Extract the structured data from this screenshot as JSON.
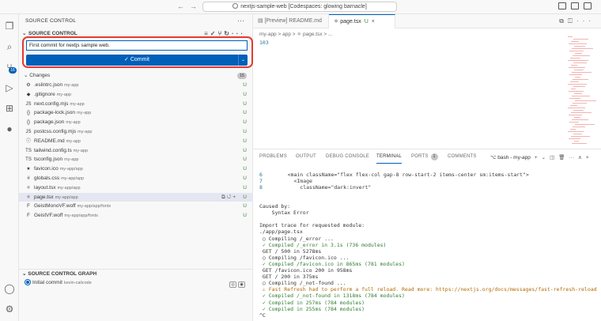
{
  "titlebar": {
    "back": "←",
    "forward": "→",
    "command_center": "nextjs-sample-web [Codespaces: glowing barnacle]"
  },
  "activity_bar": {
    "source_control_badge": "16",
    "icons": [
      "files-icon",
      "search-icon",
      "source-control-icon",
      "run-debug-icon",
      "extensions-icon",
      "github-icon",
      "account-icon",
      "settings-icon"
    ]
  },
  "sidebar": {
    "title": "SOURCE CONTROL",
    "more": "···",
    "section_title": "SOURCE CONTROL",
    "commit_message": "First commit for nextjs sample web.",
    "commit_button": "✓ Commit",
    "changes_label": "Changes",
    "changes_count": "15",
    "files": [
      {
        "name": ".eslintrc.json",
        "path": "my-app",
        "status": "U",
        "icon": "⚙"
      },
      {
        "name": ".gitignore",
        "path": "my-app",
        "status": "U",
        "icon": "◆"
      },
      {
        "name": "next.config.mjs",
        "path": "my-app",
        "status": "U",
        "icon": "JS"
      },
      {
        "name": "package-lock.json",
        "path": "my-app",
        "status": "U",
        "icon": "{}"
      },
      {
        "name": "package.json",
        "path": "my-app",
        "status": "U",
        "icon": "{}"
      },
      {
        "name": "postcss.config.mjs",
        "path": "my-app",
        "status": "U",
        "icon": "JS"
      },
      {
        "name": "README.md",
        "path": "my-app",
        "status": "U",
        "icon": "ⓘ"
      },
      {
        "name": "tailwind.config.ts",
        "path": "my-app",
        "status": "U",
        "icon": "TS"
      },
      {
        "name": "tsconfig.json",
        "path": "my-app",
        "status": "U",
        "icon": "TS"
      },
      {
        "name": "favicon.ico",
        "path": "my-app/app",
        "status": "U",
        "icon": "★"
      },
      {
        "name": "globals.css",
        "path": "my-app/app",
        "status": "U",
        "icon": "#"
      },
      {
        "name": "layout.tsx",
        "path": "my-app/app",
        "status": "U",
        "icon": "⚛"
      },
      {
        "name": "page.tsx",
        "path": "my-app/app",
        "status": "U",
        "icon": "⚛"
      },
      {
        "name": "GeistMonoVF.woff",
        "path": "my-app/app/fonts",
        "status": "U",
        "icon": "F"
      },
      {
        "name": "GeistVF.woff",
        "path": "my-app/app/fonts",
        "status": "U",
        "icon": "F"
      }
    ],
    "graph_title": "SOURCE CONTROL GRAPH",
    "graph_commit": "Initial commit",
    "graph_author": "kevin-calicode"
  },
  "editor": {
    "tabs": [
      {
        "label": "[Preview] README.md"
      },
      {
        "label": "page.tsx",
        "modified": "U"
      }
    ],
    "breadcrumbs": [
      "my-app",
      "app",
      "page.tsx",
      "..."
    ],
    "line_number": "103"
  },
  "panel": {
    "tabs": [
      "PROBLEMS",
      "OUTPUT",
      "DEBUG CONSOLE",
      "TERMINAL",
      "PORTS",
      "COMMENTS"
    ],
    "ports_count": "1",
    "terminal_name": "bash - my-app",
    "code_lines": [
      {
        "num": "6",
        "text": "    <main className=\"flex flex-col gap-8 row-start-2 items-center sm:items-start\">"
      },
      {
        "num": "7",
        "text": "      <Image"
      },
      {
        "num": "8",
        "text": "        className=\"dark:invert\""
      }
    ],
    "terminal_lines": [
      {
        "t": ""
      },
      {
        "t": "Caused by:"
      },
      {
        "t": "    Syntax Error"
      },
      {
        "t": ""
      },
      {
        "t": "Import trace for requested module:"
      },
      {
        "t": "./app/page.tsx"
      },
      {
        "t": " ○ Compiling /_error ..."
      },
      {
        "t": " ✓ Compiled /_error in 3.1s (736 modules)",
        "cls": "ok"
      },
      {
        "t": " GET / 500 in 5278ms"
      },
      {
        "t": " ○ Compiling /favicon.ico ..."
      },
      {
        "t": " ✓ Compiled /favicon.ico in 865ms (781 modules)",
        "cls": "ok"
      },
      {
        "t": " GET /favicon.ico 200 in 958ms"
      },
      {
        "t": " GET / 200 in 375ms"
      },
      {
        "t": " ○ Compiling /_not-found ..."
      },
      {
        "t": " ⚠ Fast Refresh had to perform a full reload. Read more: https://nextjs.org/docs/messages/fast-refresh-reload",
        "cls": "warn"
      },
      {
        "t": " ✓ Compiled /_not-found in 1318ms (784 modules)",
        "cls": "ok"
      },
      {
        "t": " ✓ Compiled in 257ms (784 modules)",
        "cls": "ok"
      },
      {
        "t": " ✓ Compiled in 255ms (784 modules)",
        "cls": "ok"
      },
      {
        "t": "^C"
      }
    ]
  },
  "colors": {
    "accent": "#005fb8",
    "untracked": "#388a34",
    "highlight": "#e53935"
  }
}
